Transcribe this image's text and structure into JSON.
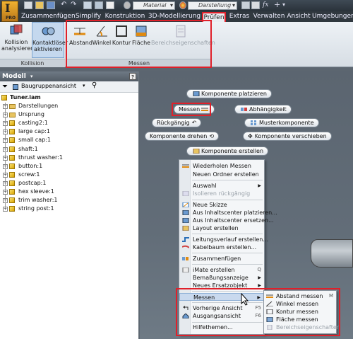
{
  "quick_access": {
    "material_placeholder": "Material",
    "appearance_placeholder": "Darstellung",
    "app_letter": "I",
    "app_sub": "PRO"
  },
  "tabs": [
    {
      "label": "Zusammenfügen"
    },
    {
      "label": "Simplify"
    },
    {
      "label": "Konstruktion"
    },
    {
      "label": "3D-Modellierung"
    },
    {
      "label": "Prüfen"
    },
    {
      "label": "Extras"
    },
    {
      "label": "Verwalten"
    },
    {
      "label": "Ansicht"
    },
    {
      "label": "Umgebungen"
    }
  ],
  "ribbon": {
    "kollision": {
      "panel_label": "Kollision",
      "analyze_line1": "Kollision",
      "analyze_line2": "analysieren",
      "contact_line1": "Kontaktlöser",
      "contact_line2": "aktivieren"
    },
    "messen": {
      "panel_label": "Messen",
      "distance": "Abstand",
      "angle": "Winkel",
      "contour": "Kontur",
      "area": "Fläche",
      "region_props": "Bereichseigenschaften"
    }
  },
  "browser": {
    "title": "Modell",
    "help": "?",
    "view_select": "Baugruppenansicht",
    "root": "Tuner.iam",
    "items": [
      {
        "label": "Darstellungen"
      },
      {
        "label": "Ursprung"
      },
      {
        "label": "casting2:1"
      },
      {
        "label": "large cap:1"
      },
      {
        "label": "small cap:1"
      },
      {
        "label": "shaft:1"
      },
      {
        "label": "thrust washer:1"
      },
      {
        "label": "button:1"
      },
      {
        "label": "screw:1"
      },
      {
        "label": "postcap:1"
      },
      {
        "label": "hex sleeve:1"
      },
      {
        "label": "trim washer:1"
      },
      {
        "label": "string post:1"
      }
    ]
  },
  "marking_menu": {
    "place_component": "Komponente platzieren",
    "measure": "Messen",
    "dependency": "Abhängigkeit",
    "undo": "Rückgängig",
    "pattern": "Musterkomponente",
    "rotate": "Komponente drehen",
    "move": "Komponente verschieben",
    "create": "Komponente erstellen"
  },
  "context_menu": {
    "repeat_measure": "Wiederholen Messen",
    "new_folder": "Neuen Ordner erstellen",
    "selection": "Auswahl",
    "isolate_undo": "Isolieren rückgängig",
    "new_sketch": "Neue Skizze",
    "place_from_cc": "Aus Inhaltscenter platzieren...",
    "replace_from_cc": "Aus Inhaltscenter ersetzen...",
    "create_layout": "Layout erstellen",
    "create_route": "Leitungsverlauf erstellen...",
    "create_harness": "Kabelbaum erstellen...",
    "assemble": "Zusammenfügen",
    "create_imate": "iMate erstellen",
    "imate_shortcut": "Q",
    "dim_display": "Bemaßungsanzeige",
    "new_substitute": "Neues Ersatzobjekt",
    "measure": "Messen",
    "prev_view": "Vorherige Ansicht",
    "prev_view_key": "F5",
    "home_view": "Ausgangsansicht",
    "home_view_key": "F6",
    "help_topics": "Hilfethemen..."
  },
  "submenu": {
    "distance": "Abstand messen",
    "distance_key": "M",
    "angle": "Winkel messen",
    "contour": "Kontur messen",
    "area": "Fläche messen",
    "region_props": "Bereichseigenschaften"
  },
  "colors": {
    "highlight_red": "#e0202a",
    "accent_blue": "#2a6fb8"
  }
}
